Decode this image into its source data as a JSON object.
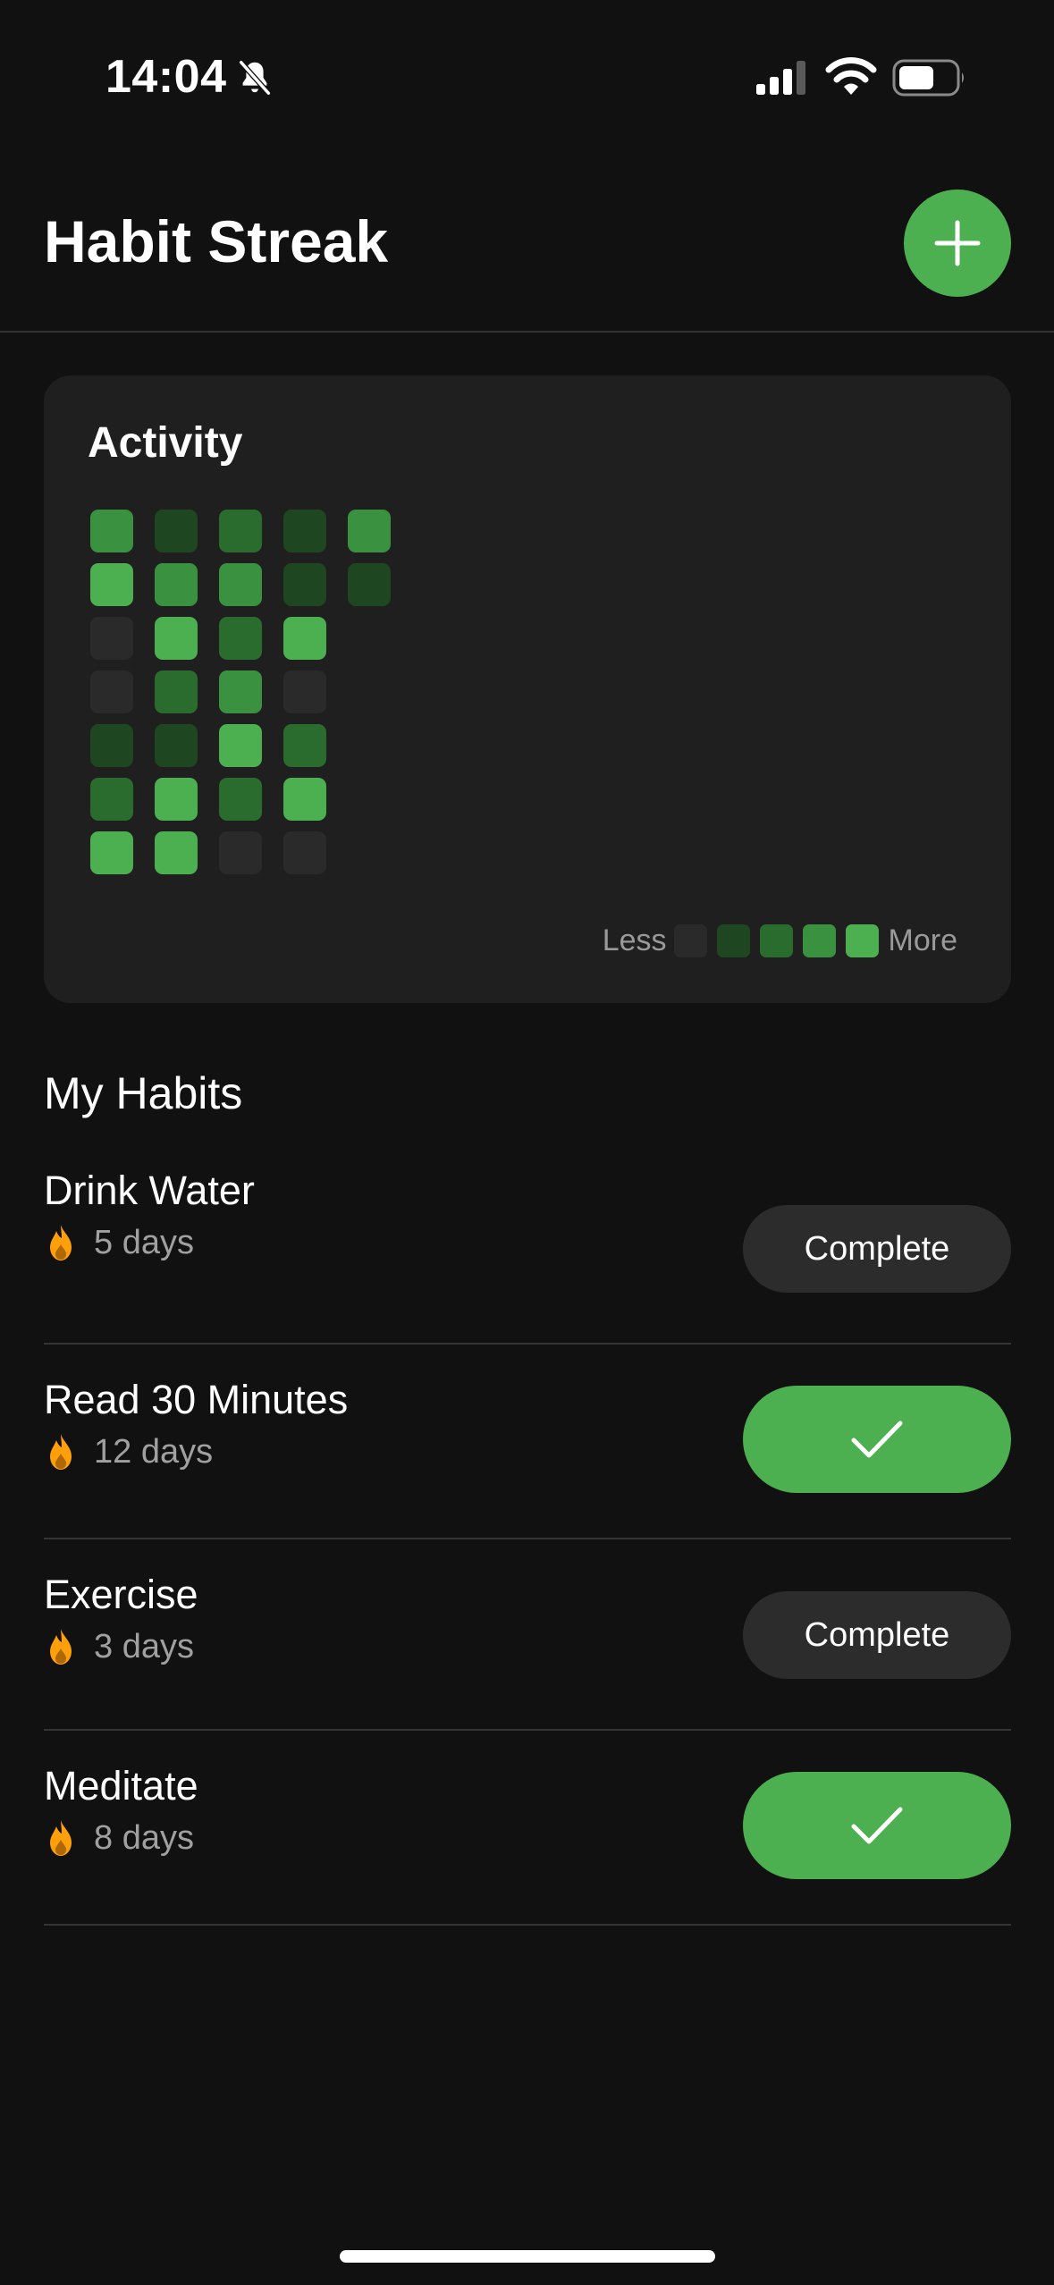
{
  "status_bar": {
    "time": "14:04",
    "icons": [
      "bell-slash-icon",
      "cellular-signal-icon",
      "wifi-icon",
      "battery-icon"
    ]
  },
  "header": {
    "title": "Habit Streak",
    "add_icon": "plus-icon"
  },
  "activity": {
    "title": "Activity",
    "legend_less": "Less",
    "legend_more": "More",
    "level_colors": [
      "#2a2a2a",
      "#1e4620",
      "#2a6b2e",
      "#3a9140",
      "#4caf50"
    ],
    "grid_columns": [
      [
        3,
        4,
        0,
        0,
        1,
        2,
        4
      ],
      [
        1,
        3,
        4,
        2,
        1,
        4,
        4
      ],
      [
        2,
        3,
        2,
        3,
        4,
        2,
        0
      ],
      [
        1,
        1,
        4,
        0,
        2,
        4,
        0
      ],
      [
        3,
        1
      ]
    ]
  },
  "habits": {
    "title": "My Habits",
    "items": [
      {
        "name": "Drink Water",
        "streak": "5 days",
        "completed": false,
        "button_label": "Complete"
      },
      {
        "name": "Read 30 Minutes",
        "streak": "12 days",
        "completed": true,
        "button_label": ""
      },
      {
        "name": "Exercise",
        "streak": "3 days",
        "completed": false,
        "button_label": "Complete"
      },
      {
        "name": "Meditate",
        "streak": "8 days",
        "completed": true,
        "button_label": ""
      }
    ],
    "flame_color": "#ff9f0a",
    "accent_color": "#4caf50"
  }
}
